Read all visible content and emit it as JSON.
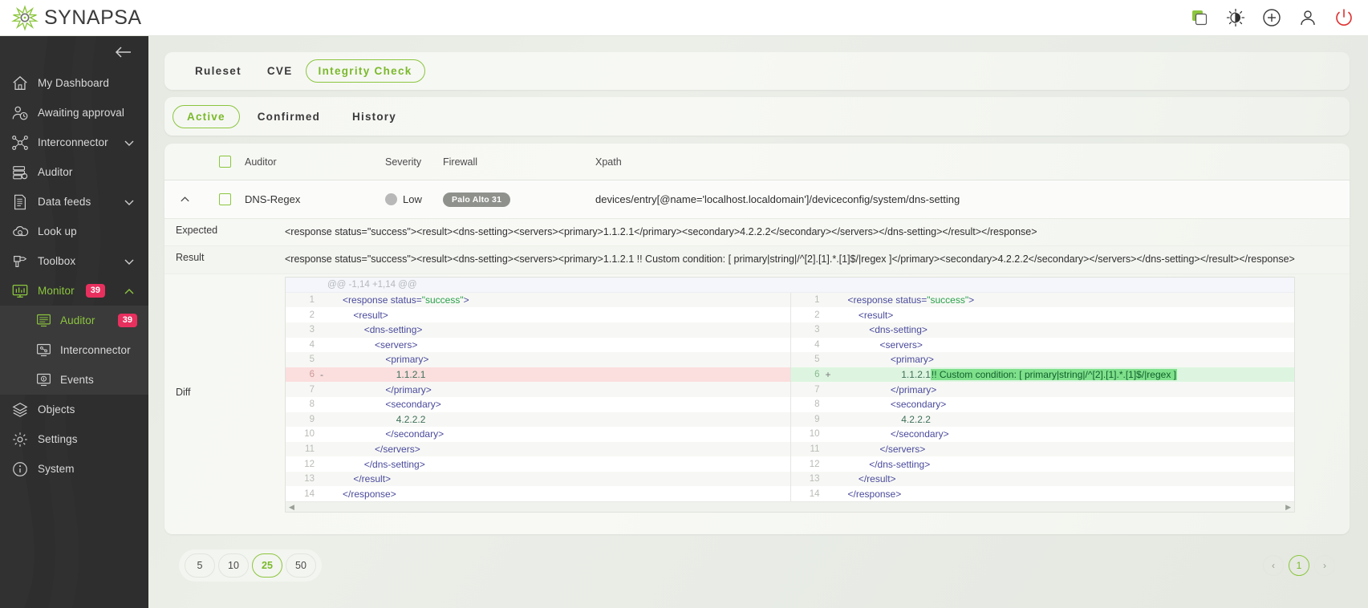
{
  "brand": {
    "name": "SYNAPSA",
    "logo_icon": "synapsa-star-logo",
    "accent": "#8cc63e"
  },
  "topbar": {
    "icons": [
      {
        "name": "copy-icon",
        "label": "Copy"
      },
      {
        "name": "theme-toggle-icon",
        "label": "Theme"
      },
      {
        "name": "add-circle-icon",
        "label": "Add"
      },
      {
        "name": "user-account-icon",
        "label": "Account"
      },
      {
        "name": "power-logout-icon",
        "label": "Logout"
      }
    ]
  },
  "sidebar": {
    "collapse_icon": "arrow-left-icon",
    "items": [
      {
        "label": "My Dashboard",
        "icon": "home-icon",
        "active": false,
        "chevron": null,
        "badge": null
      },
      {
        "label": "Awaiting approval",
        "icon": "user-clock-icon",
        "active": false,
        "chevron": null,
        "badge": null
      },
      {
        "label": "Interconnector",
        "icon": "network-nodes-icon",
        "active": false,
        "chevron": "chevron-down-icon",
        "badge": null
      },
      {
        "label": "Auditor",
        "icon": "server-search-icon",
        "active": false,
        "chevron": null,
        "badge": null
      },
      {
        "label": "Data feeds",
        "icon": "document-lines-icon",
        "active": false,
        "chevron": "chevron-down-icon",
        "badge": null
      },
      {
        "label": "Look up",
        "icon": "cloud-search-icon",
        "active": false,
        "chevron": null,
        "badge": null
      },
      {
        "label": "Toolbox",
        "icon": "drill-tool-icon",
        "active": false,
        "chevron": "chevron-down-icon",
        "badge": null
      },
      {
        "label": "Monitor",
        "icon": "monitor-chart-icon",
        "active": true,
        "chevron": "chevron-up-icon",
        "badge": "39"
      }
    ],
    "submenu": [
      {
        "label": "Auditor",
        "icon": "monitor-auditor-icon",
        "active": true,
        "badge": "39"
      },
      {
        "label": "Interconnector",
        "icon": "monitor-interconnector-icon",
        "active": false,
        "badge": null
      },
      {
        "label": "Events",
        "icon": "monitor-events-icon",
        "active": false,
        "badge": null
      }
    ],
    "items_bottom": [
      {
        "label": "Objects",
        "icon": "layers-icon"
      },
      {
        "label": "Settings",
        "icon": "gear-icon"
      },
      {
        "label": "System",
        "icon": "info-circle-icon"
      }
    ]
  },
  "tabs": [
    {
      "label": "Ruleset",
      "selected": false
    },
    {
      "label": "CVE",
      "selected": false
    },
    {
      "label": "Integrity Check",
      "selected": true
    }
  ],
  "filters": [
    {
      "label": "Active",
      "selected": true
    },
    {
      "label": "Confirmed",
      "selected": false
    },
    {
      "label": "History",
      "selected": false
    }
  ],
  "table": {
    "headers": {
      "auditor": "Auditor",
      "severity": "Severity",
      "firewall": "Firewall",
      "xpath": "Xpath"
    },
    "row": {
      "auditor": "DNS-Regex",
      "severity": "Low",
      "firewall": "Palo Alto 31",
      "xpath": "devices/entry[@name='localhost.localdomain']/deviceconfig/system/dns-setting",
      "expanded": true
    },
    "detail": {
      "expected_label": "Expected",
      "expected_value": "<response status=\"success\"><result><dns-setting><servers><primary>1.1.2.1</primary><secondary>4.2.2.2</secondary></servers></dns-setting></result></response>",
      "result_label": "Result",
      "result_value": "<response status=\"success\"><result><dns-setting><servers><primary>1.1.2.1 !! Custom condition: [ primary|string|/^[2].[1].*.[1]$/|regex ]</primary><secondary>4.2.2.2</secondary></servers></dns-setting></result></response>",
      "diff_label": "Diff"
    }
  },
  "diff": {
    "hunk": "@@ -1,14 +1,14 @@",
    "left": [
      {
        "n": "1",
        "sign": "",
        "indent": 0,
        "text": "<response status=\"success\">",
        "kind": "ctx"
      },
      {
        "n": "2",
        "sign": "",
        "indent": 1,
        "text": "<result>",
        "kind": "ctx"
      },
      {
        "n": "3",
        "sign": "",
        "indent": 2,
        "text": "<dns-setting>",
        "kind": "ctx"
      },
      {
        "n": "4",
        "sign": "",
        "indent": 3,
        "text": "<servers>",
        "kind": "ctx"
      },
      {
        "n": "5",
        "sign": "",
        "indent": 4,
        "text": "<primary>",
        "kind": "ctx"
      },
      {
        "n": "6",
        "sign": "-",
        "indent": 5,
        "text": "1.1.2.1",
        "kind": "del"
      },
      {
        "n": "7",
        "sign": "",
        "indent": 4,
        "text": "</primary>",
        "kind": "ctx"
      },
      {
        "n": "8",
        "sign": "",
        "indent": 4,
        "text": "<secondary>",
        "kind": "ctx"
      },
      {
        "n": "9",
        "sign": "",
        "indent": 5,
        "text": "4.2.2.2",
        "kind": "ctx"
      },
      {
        "n": "10",
        "sign": "",
        "indent": 4,
        "text": "</secondary>",
        "kind": "ctx"
      },
      {
        "n": "11",
        "sign": "",
        "indent": 3,
        "text": "</servers>",
        "kind": "ctx"
      },
      {
        "n": "12",
        "sign": "",
        "indent": 2,
        "text": "</dns-setting>",
        "kind": "ctx"
      },
      {
        "n": "13",
        "sign": "",
        "indent": 1,
        "text": "</result>",
        "kind": "ctx"
      },
      {
        "n": "14",
        "sign": "",
        "indent": 0,
        "text": "</response>",
        "kind": "ctx"
      }
    ],
    "right": [
      {
        "n": "1",
        "sign": "",
        "indent": 0,
        "text": "<response status=\"success\">",
        "kind": "ctx"
      },
      {
        "n": "2",
        "sign": "",
        "indent": 1,
        "text": "<result>",
        "kind": "ctx"
      },
      {
        "n": "3",
        "sign": "",
        "indent": 2,
        "text": "<dns-setting>",
        "kind": "ctx"
      },
      {
        "n": "4",
        "sign": "",
        "indent": 3,
        "text": "<servers>",
        "kind": "ctx"
      },
      {
        "n": "5",
        "sign": "",
        "indent": 4,
        "text": "<primary>",
        "kind": "ctx"
      },
      {
        "n": "6",
        "sign": "+",
        "indent": 5,
        "text": "1.1.2.1",
        "highlight": "!! Custom condition: [ primary|string|/^[2].[1].*.[1]$/|regex ]",
        "kind": "add"
      },
      {
        "n": "7",
        "sign": "",
        "indent": 4,
        "text": "</primary>",
        "kind": "ctx"
      },
      {
        "n": "8",
        "sign": "",
        "indent": 4,
        "text": "<secondary>",
        "kind": "ctx"
      },
      {
        "n": "9",
        "sign": "",
        "indent": 5,
        "text": "4.2.2.2",
        "kind": "ctx"
      },
      {
        "n": "10",
        "sign": "",
        "indent": 4,
        "text": "</secondary>",
        "kind": "ctx"
      },
      {
        "n": "11",
        "sign": "",
        "indent": 3,
        "text": "</servers>",
        "kind": "ctx"
      },
      {
        "n": "12",
        "sign": "",
        "indent": 2,
        "text": "</dns-setting>",
        "kind": "ctx"
      },
      {
        "n": "13",
        "sign": "",
        "indent": 1,
        "text": "</result>",
        "kind": "ctx"
      },
      {
        "n": "14",
        "sign": "",
        "indent": 0,
        "text": "</response>",
        "kind": "ctx"
      }
    ]
  },
  "pagination": {
    "page_sizes": [
      {
        "label": "5",
        "selected": false
      },
      {
        "label": "10",
        "selected": false
      },
      {
        "label": "25",
        "selected": true
      },
      {
        "label": "50",
        "selected": false
      }
    ],
    "prev": "‹",
    "next": "›",
    "current_page": "1"
  }
}
